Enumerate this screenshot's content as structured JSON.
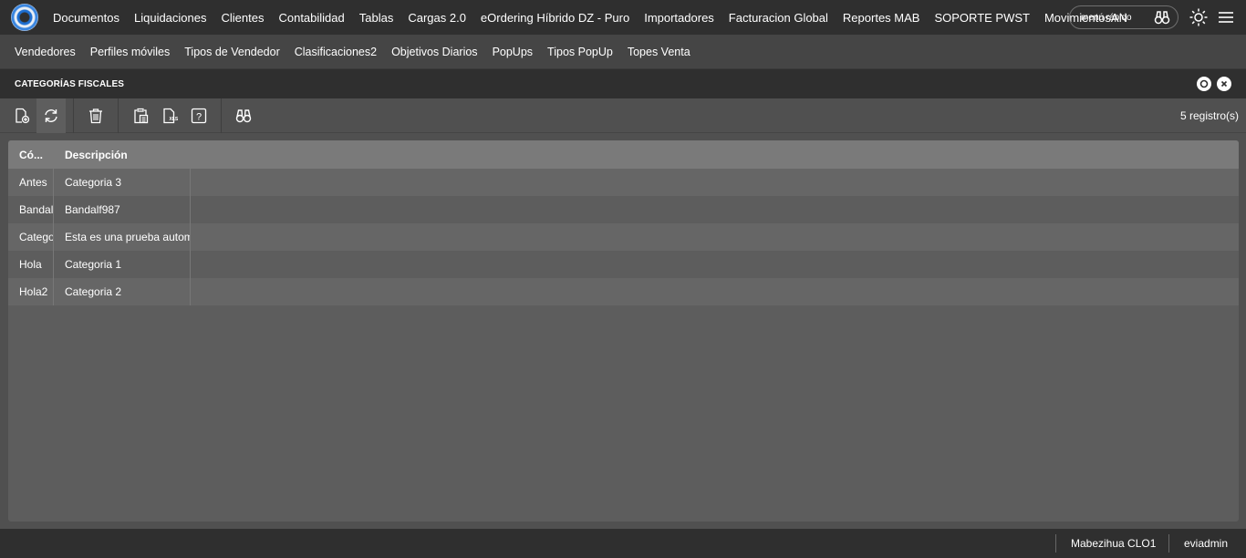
{
  "topnav": {
    "items": [
      "Documentos",
      "Liquidaciones",
      "Clientes",
      "Contabilidad",
      "Tablas",
      "Cargas 2.0",
      "eOrdering Híbrido DZ - Puro",
      "Importadores",
      "Facturacion Global",
      "Reportes MAB",
      "SOPORTE PWST",
      "MovimientosAN"
    ],
    "quick_menu_label": "menú rápido"
  },
  "subnav": {
    "items": [
      "Vendedores",
      "Perfiles móviles",
      "Tipos de Vendedor",
      "Clasificaciones2",
      "Objetivos Diarios",
      "PopUps",
      "Tipos PopUp",
      "Topes Venta"
    ]
  },
  "panel": {
    "title": "CATEGORÍAS FISCALES"
  },
  "toolbar": {
    "records_label": "5 registro(s)"
  },
  "grid": {
    "columns": [
      "Có...",
      "Descripción"
    ],
    "rows": [
      [
        "Antes",
        "Categoria 3"
      ],
      [
        "Bandalf",
        "Bandalf987"
      ],
      [
        "Categoria",
        "Esta es una prueba automatizada"
      ],
      [
        "Hola",
        "Categoria 1"
      ],
      [
        "Hola2",
        "Categoria 2"
      ]
    ]
  },
  "footer": {
    "company": "Mabezihua CLO1",
    "user": "eviadmin"
  }
}
